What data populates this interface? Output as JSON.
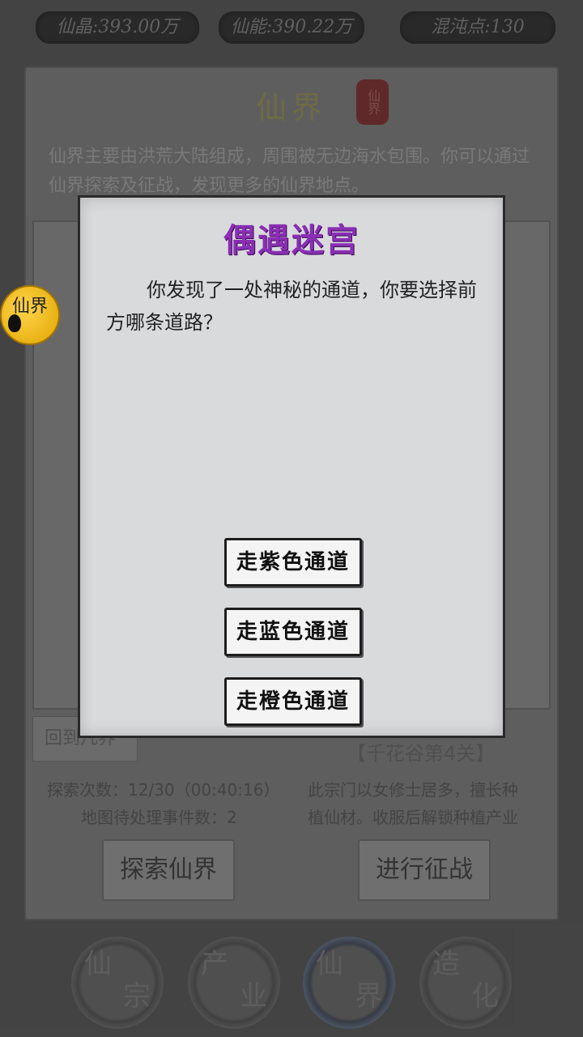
{
  "resources": {
    "crystal": "仙晶:393.00万",
    "energy": "仙能:390.22万",
    "chaos": "混沌点:130"
  },
  "panel": {
    "title": "仙界",
    "seal_text": "仙界",
    "description": "仙界主要由洪荒大陆组成，周围被无边海水包围。你可以通过仙界探索及征战，发现更多的仙界地点。",
    "back_button": "回到凡界",
    "level_name": "【千花谷第4关】",
    "explore_count": "探索次数：12/30（00:40:16）",
    "pending_events": "地图待处理事件数：2",
    "sect_desc_line1": "此宗门以女修士居多，擅长种",
    "sect_desc_line2": "植仙材。收服后解锁种植产业",
    "explore_button": "探索仙界",
    "battle_button": "进行征战"
  },
  "float_badge": {
    "text": "仙界"
  },
  "dialog": {
    "title": "偶遇迷宫",
    "body": "你发现了一处神秘的通道，你要选择前方哪条道路？",
    "choices": [
      "走紫色通道",
      "走蓝色通道",
      "走橙色通道"
    ]
  },
  "nav": [
    {
      "line1": "仙",
      "line2": "宗"
    },
    {
      "line1": "产",
      "line2": "业"
    },
    {
      "line1": "仙",
      "line2": "界"
    },
    {
      "line1": "造",
      "line2": "化"
    }
  ]
}
